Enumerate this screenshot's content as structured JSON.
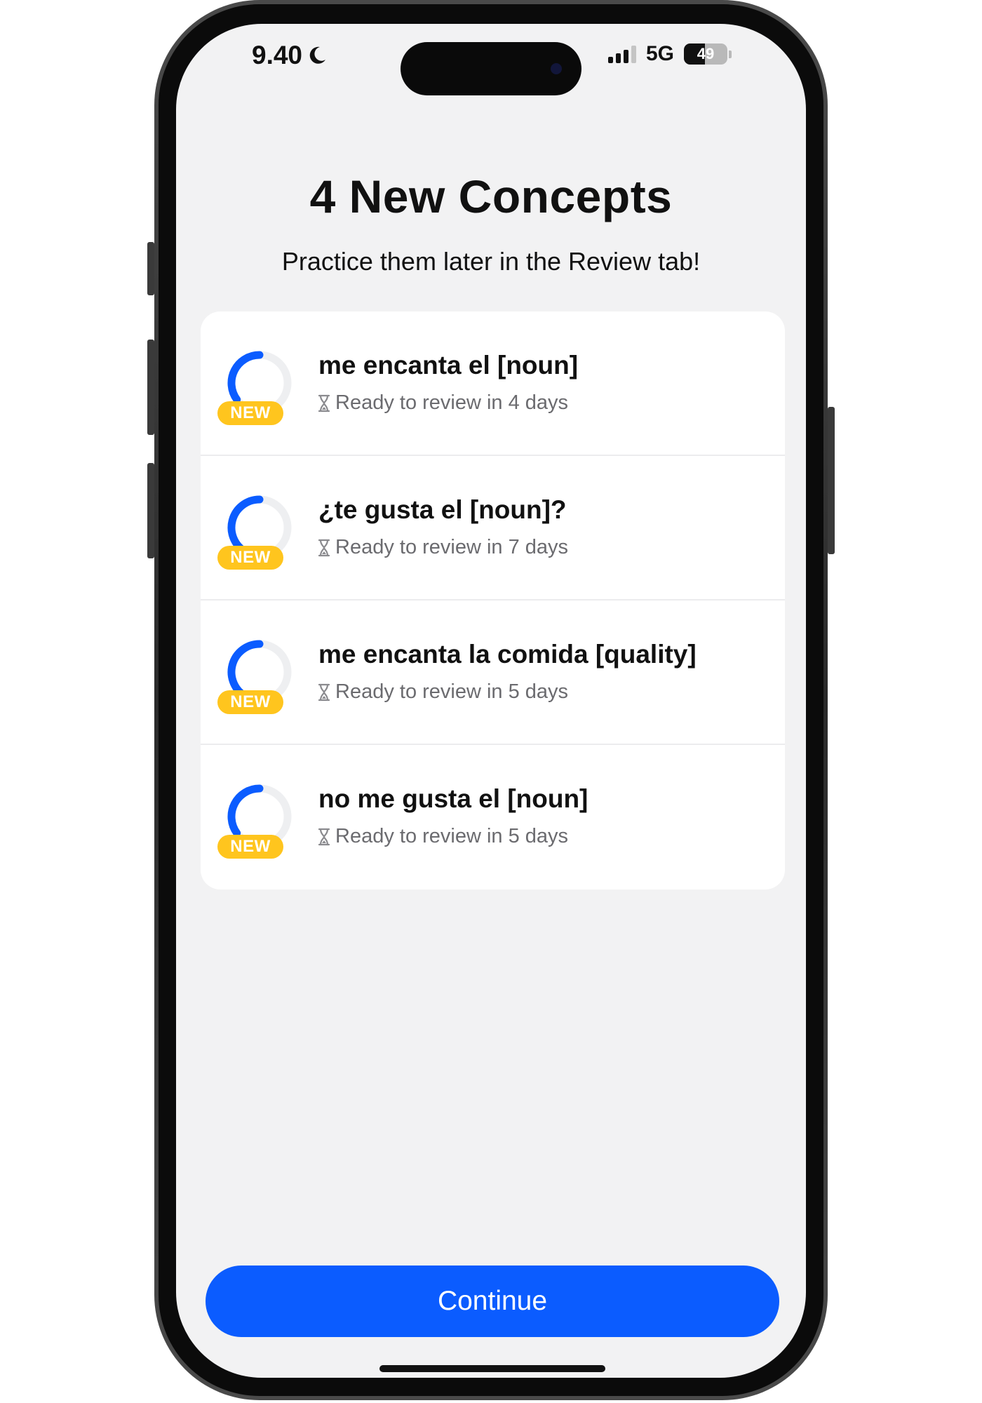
{
  "status_bar": {
    "time": "9.40",
    "time_icon": "moon-icon",
    "signal_icon": "cellular-signal-icon",
    "network": "5G",
    "battery_percent": "49",
    "battery_level": 0.49
  },
  "header": {
    "title": "4 New Concepts",
    "subtitle": "Practice them later in the Review tab!"
  },
  "concepts": [
    {
      "title": "me encanta el [noun]",
      "status": "Ready to review in 4 days",
      "badge": "NEW",
      "progress": 0.35,
      "icon": "hourglass-icon"
    },
    {
      "title": "¿te gusta el [noun]?",
      "status": "Ready to review in 7 days",
      "badge": "NEW",
      "progress": 0.42,
      "icon": "hourglass-icon"
    },
    {
      "title": "me encanta la comida [quality]",
      "status": "Ready to review in 5 days",
      "badge": "NEW",
      "progress": 0.42,
      "icon": "hourglass-icon"
    },
    {
      "title": "no me gusta el [noun]",
      "status": "Ready to review in 5 days",
      "badge": "NEW",
      "progress": 0.35,
      "icon": "hourglass-icon"
    }
  ],
  "continue_button": {
    "label": "Continue"
  },
  "colors": {
    "accent_blue": "#0b5cff",
    "badge_yellow": "#ffc51e",
    "background": "#f2f2f3",
    "card": "#ffffff",
    "ring_track": "#eeeff1"
  }
}
